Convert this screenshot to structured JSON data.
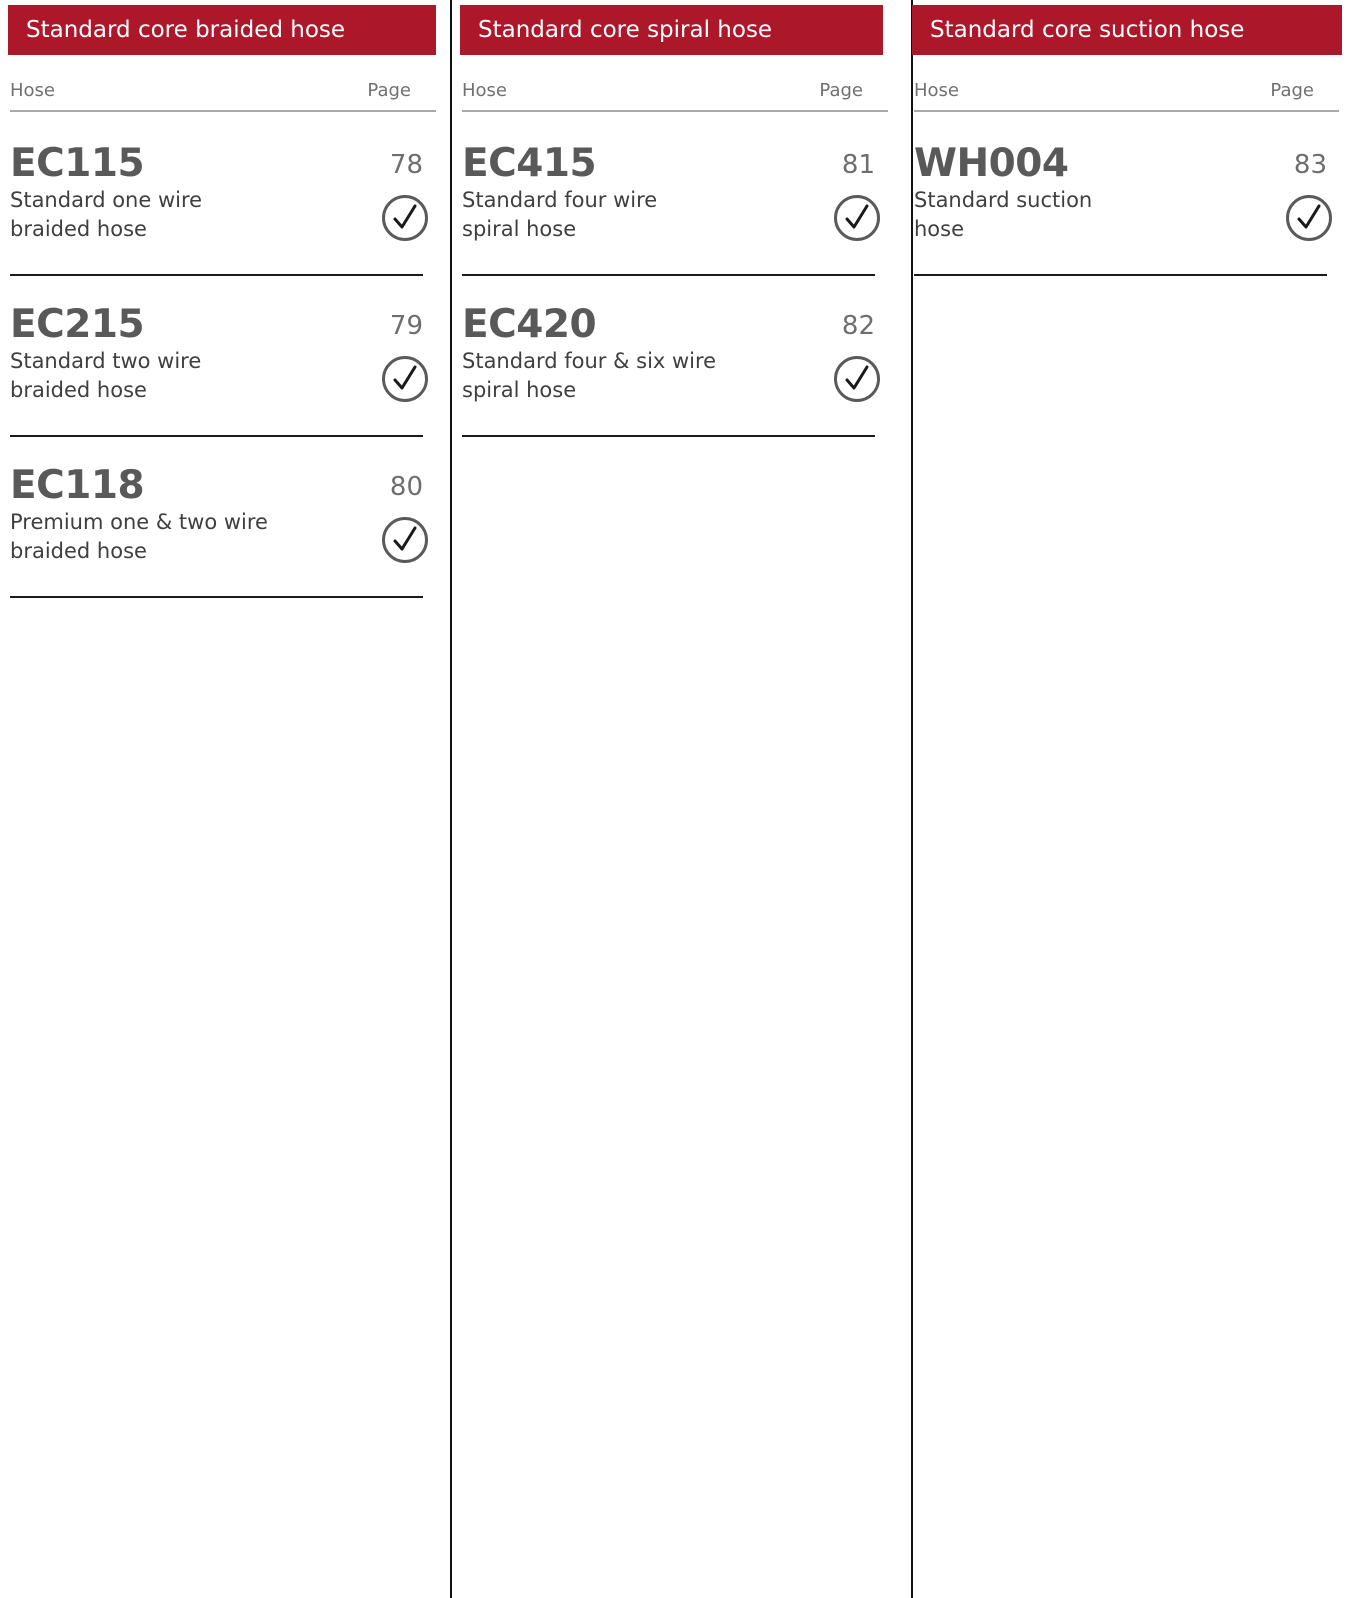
{
  "columns": [
    {
      "title": "Standard core braided hose",
      "hose_header": "Hose",
      "page_header": "Page",
      "entries": [
        {
          "code": "EC115",
          "page": "78",
          "desc_line1": "Standard one wire",
          "desc_line2": "braided hose"
        },
        {
          "code": "EC215",
          "page": "79",
          "desc_line1": "Standard two wire",
          "desc_line2": "braided hose"
        },
        {
          "code": "EC118",
          "page": "80",
          "desc_line1": "Premium one & two wire",
          "desc_line2": "braided hose"
        }
      ]
    },
    {
      "title": "Standard core spiral hose",
      "hose_header": "Hose",
      "page_header": "Page",
      "entries": [
        {
          "code": "EC415",
          "page": "81",
          "desc_line1": "Standard four wire",
          "desc_line2": "spiral hose"
        },
        {
          "code": "EC420",
          "page": "82",
          "desc_line1": "Standard four & six wire",
          "desc_line2": "spiral hose"
        }
      ]
    },
    {
      "title": "Standard core suction hose",
      "hose_header": "Hose",
      "page_header": "Page",
      "entries": [
        {
          "code": "WH004",
          "page": "83",
          "desc_line1": "Standard suction",
          "desc_line2": "hose"
        }
      ]
    }
  ],
  "icons": {
    "check": "circle-check-icon"
  },
  "colors": {
    "banner": "#ac1829",
    "text": "#555555",
    "rule": "#1a1a1a"
  }
}
